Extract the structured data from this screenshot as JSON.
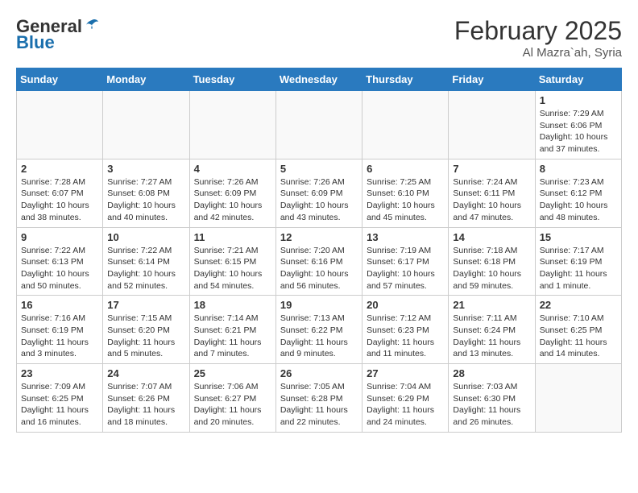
{
  "header": {
    "logo_general": "General",
    "logo_blue": "Blue",
    "month_title": "February 2025",
    "location": "Al Mazra`ah, Syria"
  },
  "weekdays": [
    "Sunday",
    "Monday",
    "Tuesday",
    "Wednesday",
    "Thursday",
    "Friday",
    "Saturday"
  ],
  "weeks": [
    [
      {
        "day": "",
        "info": ""
      },
      {
        "day": "",
        "info": ""
      },
      {
        "day": "",
        "info": ""
      },
      {
        "day": "",
        "info": ""
      },
      {
        "day": "",
        "info": ""
      },
      {
        "day": "",
        "info": ""
      },
      {
        "day": "1",
        "info": "Sunrise: 7:29 AM\nSunset: 6:06 PM\nDaylight: 10 hours\nand 37 minutes."
      }
    ],
    [
      {
        "day": "2",
        "info": "Sunrise: 7:28 AM\nSunset: 6:07 PM\nDaylight: 10 hours\nand 38 minutes."
      },
      {
        "day": "3",
        "info": "Sunrise: 7:27 AM\nSunset: 6:08 PM\nDaylight: 10 hours\nand 40 minutes."
      },
      {
        "day": "4",
        "info": "Sunrise: 7:26 AM\nSunset: 6:09 PM\nDaylight: 10 hours\nand 42 minutes."
      },
      {
        "day": "5",
        "info": "Sunrise: 7:26 AM\nSunset: 6:09 PM\nDaylight: 10 hours\nand 43 minutes."
      },
      {
        "day": "6",
        "info": "Sunrise: 7:25 AM\nSunset: 6:10 PM\nDaylight: 10 hours\nand 45 minutes."
      },
      {
        "day": "7",
        "info": "Sunrise: 7:24 AM\nSunset: 6:11 PM\nDaylight: 10 hours\nand 47 minutes."
      },
      {
        "day": "8",
        "info": "Sunrise: 7:23 AM\nSunset: 6:12 PM\nDaylight: 10 hours\nand 48 minutes."
      }
    ],
    [
      {
        "day": "9",
        "info": "Sunrise: 7:22 AM\nSunset: 6:13 PM\nDaylight: 10 hours\nand 50 minutes."
      },
      {
        "day": "10",
        "info": "Sunrise: 7:22 AM\nSunset: 6:14 PM\nDaylight: 10 hours\nand 52 minutes."
      },
      {
        "day": "11",
        "info": "Sunrise: 7:21 AM\nSunset: 6:15 PM\nDaylight: 10 hours\nand 54 minutes."
      },
      {
        "day": "12",
        "info": "Sunrise: 7:20 AM\nSunset: 6:16 PM\nDaylight: 10 hours\nand 56 minutes."
      },
      {
        "day": "13",
        "info": "Sunrise: 7:19 AM\nSunset: 6:17 PM\nDaylight: 10 hours\nand 57 minutes."
      },
      {
        "day": "14",
        "info": "Sunrise: 7:18 AM\nSunset: 6:18 PM\nDaylight: 10 hours\nand 59 minutes."
      },
      {
        "day": "15",
        "info": "Sunrise: 7:17 AM\nSunset: 6:19 PM\nDaylight: 11 hours\nand 1 minute."
      }
    ],
    [
      {
        "day": "16",
        "info": "Sunrise: 7:16 AM\nSunset: 6:19 PM\nDaylight: 11 hours\nand 3 minutes."
      },
      {
        "day": "17",
        "info": "Sunrise: 7:15 AM\nSunset: 6:20 PM\nDaylight: 11 hours\nand 5 minutes."
      },
      {
        "day": "18",
        "info": "Sunrise: 7:14 AM\nSunset: 6:21 PM\nDaylight: 11 hours\nand 7 minutes."
      },
      {
        "day": "19",
        "info": "Sunrise: 7:13 AM\nSunset: 6:22 PM\nDaylight: 11 hours\nand 9 minutes."
      },
      {
        "day": "20",
        "info": "Sunrise: 7:12 AM\nSunset: 6:23 PM\nDaylight: 11 hours\nand 11 minutes."
      },
      {
        "day": "21",
        "info": "Sunrise: 7:11 AM\nSunset: 6:24 PM\nDaylight: 11 hours\nand 13 minutes."
      },
      {
        "day": "22",
        "info": "Sunrise: 7:10 AM\nSunset: 6:25 PM\nDaylight: 11 hours\nand 14 minutes."
      }
    ],
    [
      {
        "day": "23",
        "info": "Sunrise: 7:09 AM\nSunset: 6:25 PM\nDaylight: 11 hours\nand 16 minutes."
      },
      {
        "day": "24",
        "info": "Sunrise: 7:07 AM\nSunset: 6:26 PM\nDaylight: 11 hours\nand 18 minutes."
      },
      {
        "day": "25",
        "info": "Sunrise: 7:06 AM\nSunset: 6:27 PM\nDaylight: 11 hours\nand 20 minutes."
      },
      {
        "day": "26",
        "info": "Sunrise: 7:05 AM\nSunset: 6:28 PM\nDaylight: 11 hours\nand 22 minutes."
      },
      {
        "day": "27",
        "info": "Sunrise: 7:04 AM\nSunset: 6:29 PM\nDaylight: 11 hours\nand 24 minutes."
      },
      {
        "day": "28",
        "info": "Sunrise: 7:03 AM\nSunset: 6:30 PM\nDaylight: 11 hours\nand 26 minutes."
      },
      {
        "day": "",
        "info": ""
      }
    ]
  ]
}
